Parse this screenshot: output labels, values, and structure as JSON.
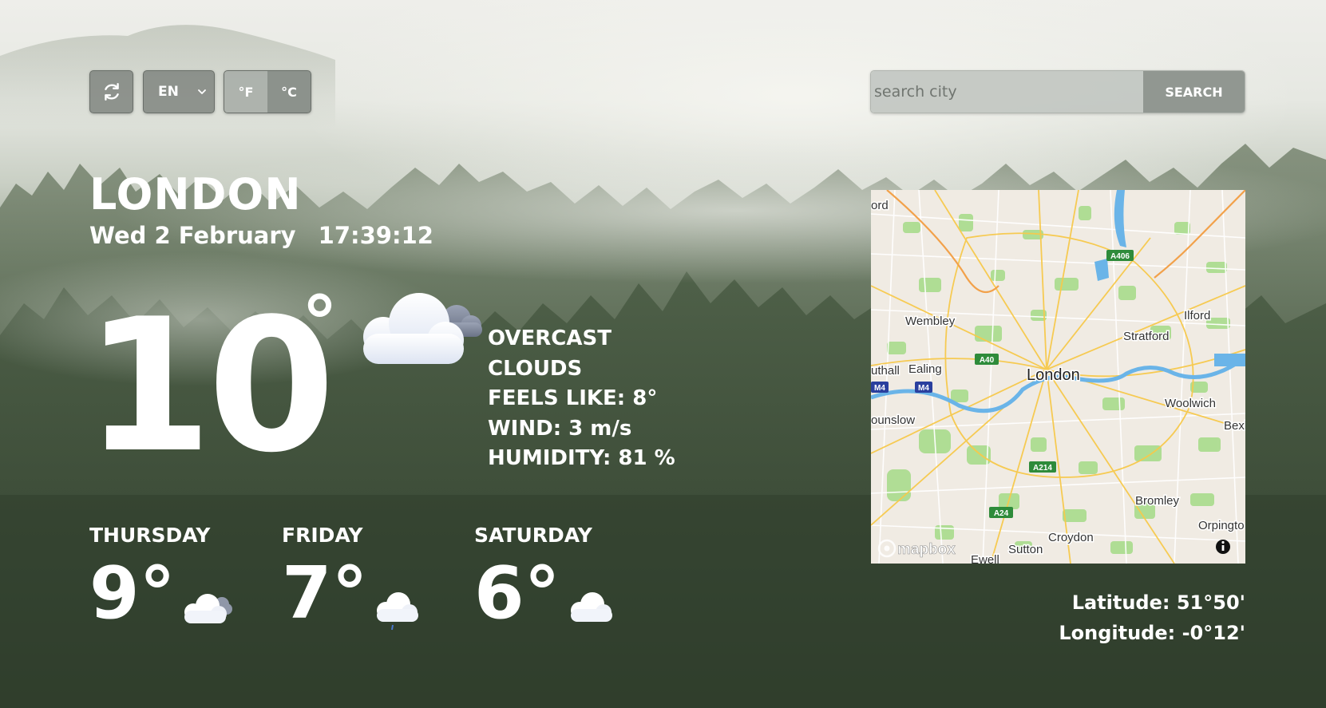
{
  "controls": {
    "language": "EN",
    "unit_f": "°F",
    "unit_c": "°C",
    "active_unit": "°C"
  },
  "search": {
    "placeholder": "search city",
    "button_label": "SEARCH"
  },
  "location": {
    "city": "LONDON",
    "date": "Wed 2 February",
    "time": "17:39:12"
  },
  "current": {
    "temperature": "10",
    "degree_symbol": "°",
    "icon": "overcast-clouds-icon",
    "description_line1": "OVERCAST",
    "description_line2": "CLOUDS",
    "feels_like": "FEELS LIKE: 8°",
    "wind": "WIND: 3 m/s",
    "humidity": "HUMIDITY: 81 %"
  },
  "forecast": [
    {
      "day": "THURSDAY",
      "temp": "9°",
      "icon": "broken-clouds-icon"
    },
    {
      "day": "FRIDAY",
      "temp": "7°",
      "icon": "rain-cloud-icon"
    },
    {
      "day": "SATURDAY",
      "temp": "6°",
      "icon": "cloud-icon"
    }
  ],
  "map": {
    "labels": {
      "ford": "ord",
      "wembley": "Wembley",
      "ilford": "Ilford",
      "stratford": "Stratford",
      "southall": "uthall",
      "ealing": "Ealing",
      "london": "London",
      "woolwich": "Woolwich",
      "bexley": "Bexl",
      "hounslow": "ounslow",
      "bromley": "Bromley",
      "orpington": "Orpingto",
      "croydon": "Croydon",
      "sutton": "Sutton",
      "ewell": "Ewell",
      "a406": "A406",
      "a40": "A40",
      "m4a": "M4",
      "m4b": "M4",
      "a214": "A214",
      "a24": "A24",
      "attribution": "mapbox"
    }
  },
  "coordinates": {
    "latitude": "Latitude: 51°50'",
    "longitude": "Longitude: -0°12'"
  }
}
